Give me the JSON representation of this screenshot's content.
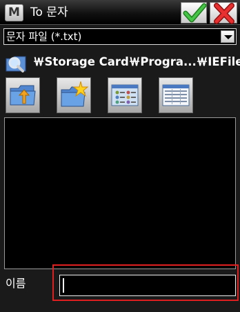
{
  "titlebar": {
    "app_icon_letter": "M",
    "title": "To 문자",
    "ok_icon": "checkmark-icon",
    "cancel_icon": "x-icon"
  },
  "filetype": {
    "selected": "문자 파일 (*.txt)"
  },
  "path": {
    "icon": "magnifier-folder-icon",
    "text": "￦Storage Card￦Progra...￦IEFiles"
  },
  "toolbar": {
    "buttons": [
      {
        "icon": "folder-up-icon"
      },
      {
        "icon": "new-folder-icon"
      },
      {
        "icon": "list-view-icon"
      },
      {
        "icon": "detail-view-icon"
      }
    ]
  },
  "name_field": {
    "label": "이름",
    "value": ""
  },
  "colors": {
    "highlight": "#e02020",
    "check_green": "#2fa12f",
    "x_red": "#d42020"
  }
}
